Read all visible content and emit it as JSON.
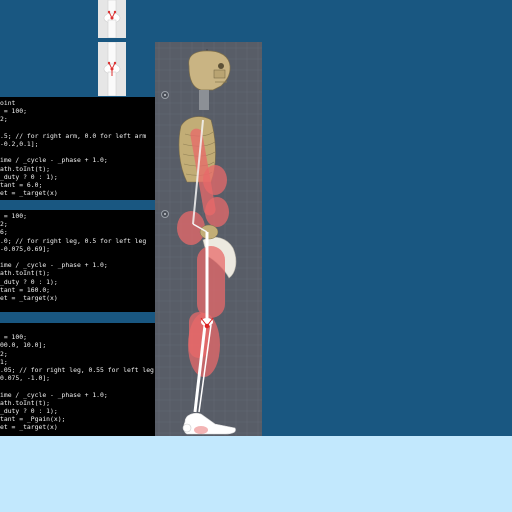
{
  "thumbnails": [
    {
      "name": "knee-joint-thumbnail-top"
    },
    {
      "name": "knee-joint-thumbnail-bottom"
    }
  ],
  "code_panels": [
    {
      "name": "arm-joint-code",
      "lines": [
        "oint",
        " = 100;",
        "2;",
        "",
        ".5; // for right arm, 0.0 for left arm",
        "-0.2,0.1];",
        "",
        "ime / _cycle - _phase + 1.0;",
        "ath.toInt(t);",
        "_duty ? 0 : 1);",
        "tant = 6.0;",
        "et = _target(x)"
      ]
    },
    {
      "name": "leg-joint-code",
      "lines": [
        " = 100;",
        "2;",
        "6;",
        ".0; // for right leg, 0.5 for left leg",
        "-0.075,0.69];",
        "",
        "ime / _cycle - _phase + 1.0;",
        "ath.toInt(t);",
        "_duty ? 0 : 1);",
        "tant = 160.0;",
        "et = _target(x)"
      ]
    },
    {
      "name": "foot-joint-code",
      "lines": [
        "",
        " = 100;",
        "00.0, 10.0];",
        "2;",
        "1;",
        ".05; // for right leg, 0.55 for left leg.",
        "0.075, -1.0];",
        "",
        "ime / _cycle - _phase + 1.0;",
        "ath.toInt(t);",
        "_duty ? 0 : 1);",
        "tant = _Pgain(x);",
        "et = _target(x)"
      ]
    }
  ],
  "viewport": {
    "background": "#585d67",
    "grid_color": "#636874",
    "muscle_color": "#e8696a",
    "bone_color": "#ffffff",
    "skull_color": "#c9b483"
  },
  "colors": {
    "background": "#195781",
    "ground": "#c2e8fd",
    "code_bg": "#000000",
    "code_text": "#f2f2f2"
  }
}
